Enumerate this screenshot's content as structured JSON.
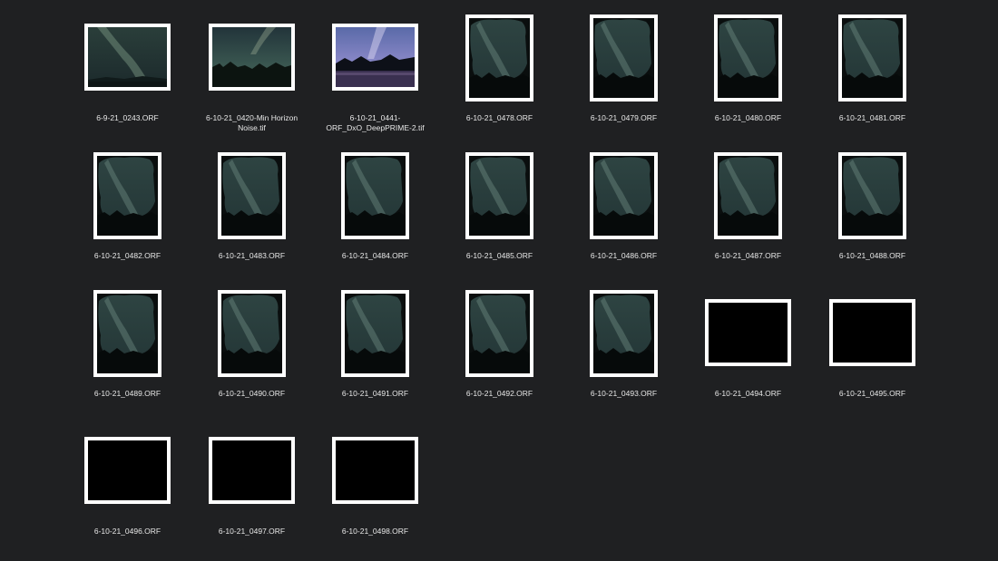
{
  "files": [
    {
      "name": "6-9-21_0243.ORF",
      "thumb": "milky-way-landscape-wide"
    },
    {
      "name": "6-10-21_0420-Min Horizon\nNoise.tif",
      "thumb": "milky-way-landscape-horizon"
    },
    {
      "name": "6-10-21_0441-\nORF_DxO_DeepPRIME-2.tif",
      "thumb": "milky-way-landscape-lake"
    },
    {
      "name": "6-10-21_0478.ORF",
      "thumb": "milky-way-portrait"
    },
    {
      "name": "6-10-21_0479.ORF",
      "thumb": "milky-way-portrait"
    },
    {
      "name": "6-10-21_0480.ORF",
      "thumb": "milky-way-portrait"
    },
    {
      "name": "6-10-21_0481.ORF",
      "thumb": "milky-way-portrait"
    },
    {
      "name": "6-10-21_0482.ORF",
      "thumb": "milky-way-portrait"
    },
    {
      "name": "6-10-21_0483.ORF",
      "thumb": "milky-way-portrait"
    },
    {
      "name": "6-10-21_0484.ORF",
      "thumb": "milky-way-portrait"
    },
    {
      "name": "6-10-21_0485.ORF",
      "thumb": "milky-way-portrait"
    },
    {
      "name": "6-10-21_0486.ORF",
      "thumb": "milky-way-portrait"
    },
    {
      "name": "6-10-21_0487.ORF",
      "thumb": "milky-way-portrait"
    },
    {
      "name": "6-10-21_0488.ORF",
      "thumb": "milky-way-portrait"
    },
    {
      "name": "6-10-21_0489.ORF",
      "thumb": "milky-way-portrait"
    },
    {
      "name": "6-10-21_0490.ORF",
      "thumb": "milky-way-portrait"
    },
    {
      "name": "6-10-21_0491.ORF",
      "thumb": "milky-way-portrait"
    },
    {
      "name": "6-10-21_0492.ORF",
      "thumb": "milky-way-portrait"
    },
    {
      "name": "6-10-21_0493.ORF",
      "thumb": "milky-way-portrait"
    },
    {
      "name": "6-10-21_0494.ORF",
      "thumb": "black-frame-landscape"
    },
    {
      "name": "6-10-21_0495.ORF",
      "thumb": "black-frame-landscape"
    },
    {
      "name": "6-10-21_0496.ORF",
      "thumb": "black-frame-landscape"
    },
    {
      "name": "6-10-21_0497.ORF",
      "thumb": "black-frame-landscape"
    },
    {
      "name": "6-10-21_0498.ORF",
      "thumb": "black-frame-landscape"
    }
  ],
  "colors": {
    "background": "#1f2022",
    "thumb_border": "#ffffff",
    "label": "#e8e8e8"
  }
}
